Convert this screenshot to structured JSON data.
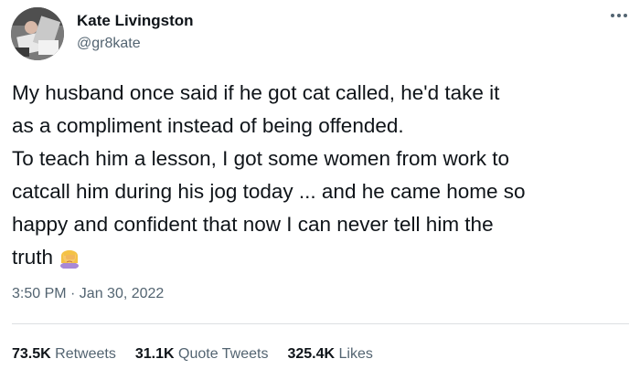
{
  "author": {
    "name": "Kate Livingston",
    "handle": "@gr8kate"
  },
  "more_icon": "more-horizontal-icon",
  "tweet": {
    "lines": [
      "My husband once said if he got cat called, he'd take it",
      "as a compliment instead of being offended.",
      "To teach him a lesson, I got some women from work to",
      "catcall him during his jog today ... and he came home so",
      "happy and confident that now I can never tell him the",
      "truth"
    ],
    "emoji": "woman-facepalming-emoji"
  },
  "timestamp": "3:50 PM · Jan 30, 2022",
  "stats": {
    "retweets": {
      "count": "73.5K",
      "label": "Retweets"
    },
    "quote_tweets": {
      "count": "31.1K",
      "label": "Quote Tweets"
    },
    "likes": {
      "count": "325.4K",
      "label": "Likes"
    }
  },
  "colors": {
    "text": "#0f1419",
    "secondary": "#536471",
    "divider": "#dcdfe2"
  }
}
